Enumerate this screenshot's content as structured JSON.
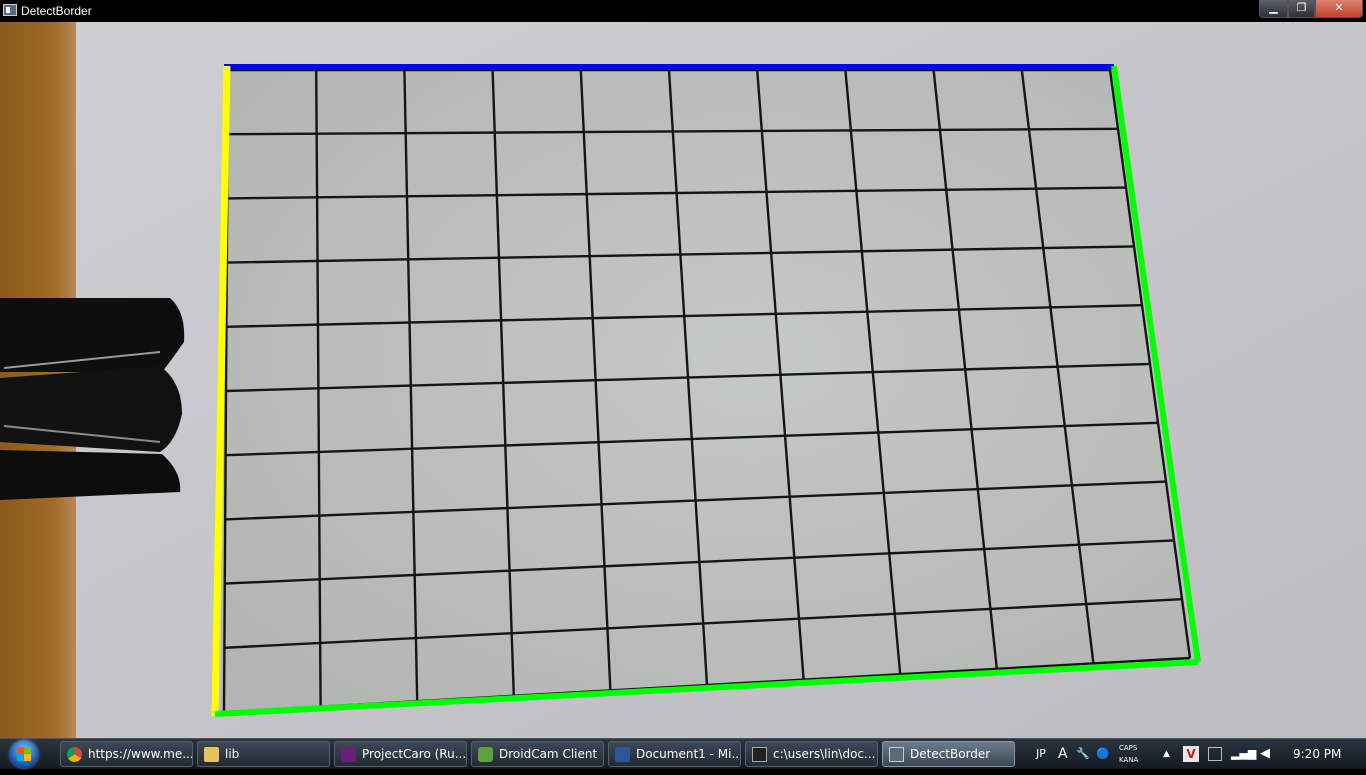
{
  "window": {
    "title": "DetectBorder",
    "minimize_glyph": "▁",
    "maximize_glyph": "❐",
    "close_glyph": "✕"
  },
  "taskbar": {
    "items": [
      {
        "label": "https://www.me...",
        "icon": "chrome-icon",
        "active": false
      },
      {
        "label": "lib",
        "icon": "folder-icon",
        "active": false
      },
      {
        "label": "ProjectCaro (Ru...",
        "icon": "visual-studio-icon",
        "active": false
      },
      {
        "label": "DroidCam Client",
        "icon": "droidcam-icon",
        "active": false
      },
      {
        "label": "Document1 - Mi...",
        "icon": "word-icon",
        "active": false
      },
      {
        "label": "c:\\users\\lin\\doc...",
        "icon": "console-icon",
        "active": false
      },
      {
        "label": "DetectBorder",
        "icon": "app-window-icon",
        "active": true
      }
    ],
    "tray": {
      "language": "JP",
      "ime_mode": "A",
      "caps": "CAPS",
      "kana": "KANA",
      "show_hidden_glyph": "▲",
      "time": "9:20 PM"
    }
  },
  "colors": {
    "top_border": "#0000ff",
    "left_border": "#ffff00",
    "right_bottom_border": "#00ff00",
    "paper": "#bcc0bd",
    "background": "#c9c8cc"
  }
}
